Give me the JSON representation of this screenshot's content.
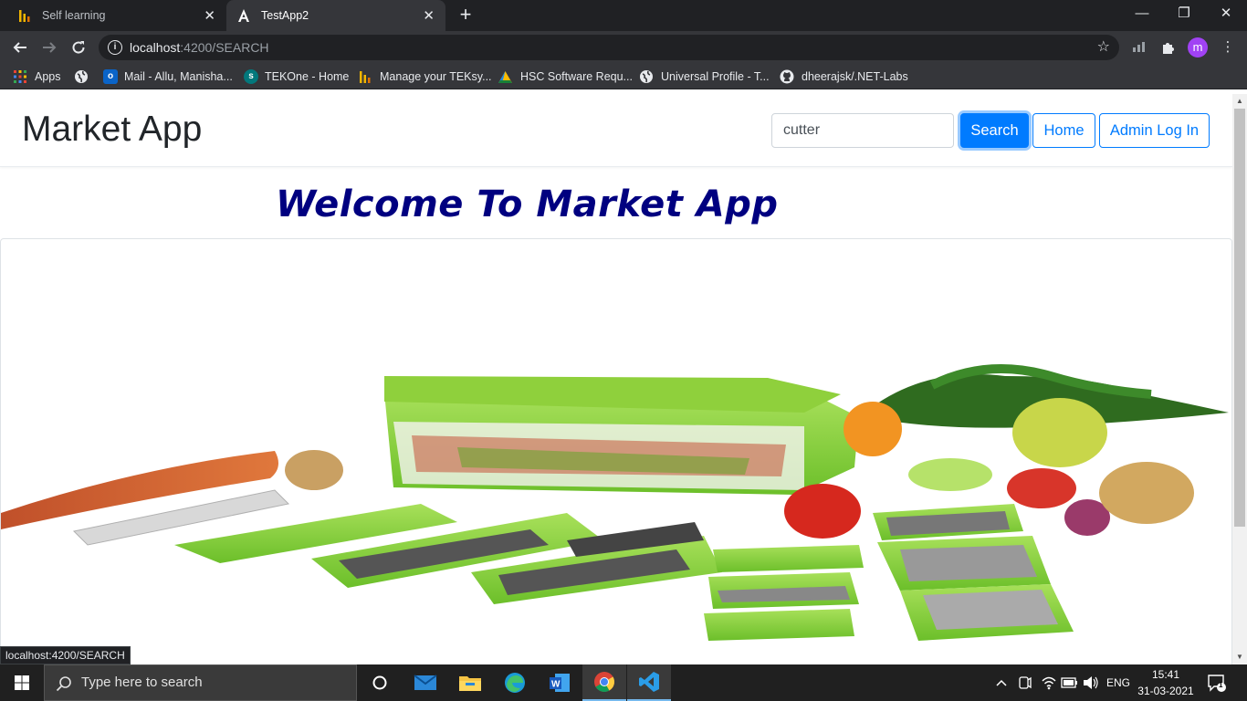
{
  "browser": {
    "tabs": [
      {
        "title": "Self learning",
        "active": false,
        "close": "✕"
      },
      {
        "title": "TestApp2",
        "active": true,
        "close": "✕"
      }
    ],
    "new_tab": "+",
    "window_controls": {
      "minimize": "—",
      "restore": "❐",
      "close": "✕"
    },
    "url_host": "localhost",
    "url_rest": ":4200/SEARCH",
    "avatar_letter": "m",
    "bookmarks": [
      {
        "label": "Apps"
      },
      {
        "label": ""
      },
      {
        "label": "Mail - Allu, Manisha..."
      },
      {
        "label": "TEKOne - Home"
      },
      {
        "label": "Manage your TEKsy..."
      },
      {
        "label": "HSC Software Requ..."
      },
      {
        "label": "Universal Profile - T..."
      },
      {
        "label": "dheerajsk/.NET-Labs"
      }
    ],
    "status_url": "localhost:4200/SEARCH"
  },
  "app": {
    "brand": "Market App",
    "search_value": "cutter",
    "search_button": "Search",
    "home_button": "Home",
    "admin_button": "Admin Log In",
    "welcome": "Welcome To Market App",
    "accent_color": "#007bff",
    "welcome_color": "#000080"
  },
  "taskbar": {
    "search_placeholder": "Type here to search",
    "language": "ENG",
    "time": "15:41",
    "date": "31-03-2021",
    "notification_count": "1"
  }
}
